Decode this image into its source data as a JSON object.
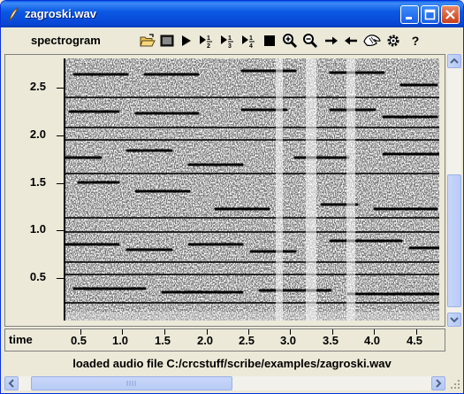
{
  "window": {
    "title": "zagroski.wav"
  },
  "toolbar": {
    "label": "spectrogram",
    "tools": [
      {
        "name": "open-icon"
      },
      {
        "name": "display-icon"
      },
      {
        "name": "play-icon"
      },
      {
        "name": "play-half-speed-icon",
        "fraction": "1/2"
      },
      {
        "name": "play-third-speed-icon",
        "fraction": "1/3"
      },
      {
        "name": "play-quarter-speed-icon",
        "fraction": "1/4"
      },
      {
        "name": "stop-icon"
      },
      {
        "name": "zoom-in-icon"
      },
      {
        "name": "zoom-out-icon"
      },
      {
        "name": "arrow-right-icon"
      },
      {
        "name": "arrow-left-icon"
      },
      {
        "name": "hand-icon"
      },
      {
        "name": "gear-icon"
      },
      {
        "name": "help-icon",
        "label": "?"
      }
    ]
  },
  "yaxis": {
    "labels": [
      "2.5",
      "2.0",
      "1.5",
      "1.0",
      "0.5"
    ]
  },
  "xaxis": {
    "title": "time",
    "labels": [
      "0.5",
      "1.0",
      "1.5",
      "2.0",
      "2.5",
      "3.0",
      "3.5",
      "4.0",
      "4.5"
    ]
  },
  "status": "loaded audio file C:/crcstuff/scribe/examples/zagroski.wav"
}
